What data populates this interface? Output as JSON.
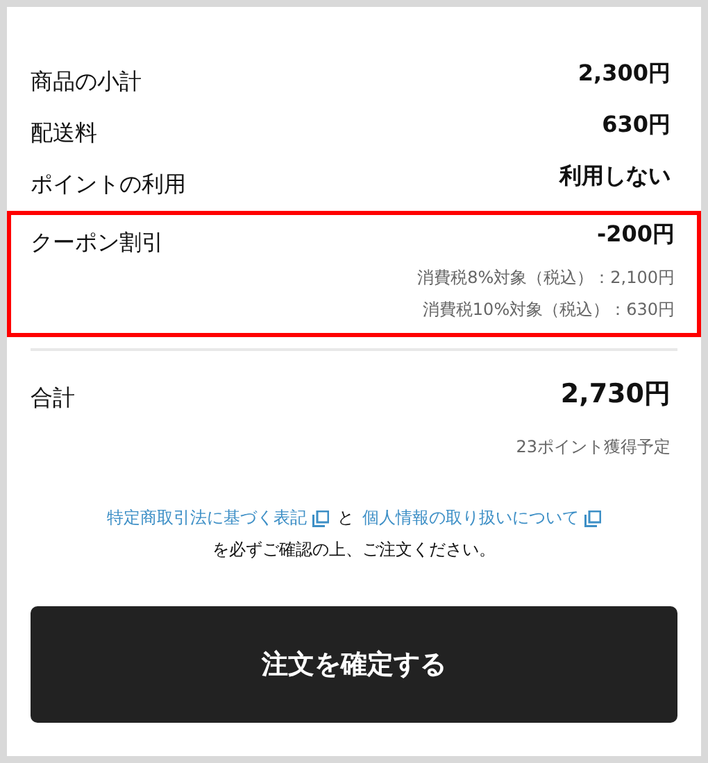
{
  "summary_rows": [
    {
      "label": "商品の小計",
      "value": "2,300円",
      "highlighted": false
    },
    {
      "label": "配送料",
      "value": "630円",
      "highlighted": false
    },
    {
      "label": "ポイントの利用",
      "value": "利用しない",
      "highlighted": false
    },
    {
      "label": "クーポン割引",
      "value": "-200円",
      "highlighted": true,
      "details": [
        "消費税8%対象（税込）：2,100円",
        "消費税10%対象（税込）：630円"
      ]
    }
  ],
  "total": {
    "label": "合計",
    "value": "2,730円",
    "points_note": "23ポイント獲得予定"
  },
  "notice": {
    "links": [
      "特定商取引法に基づく表記",
      "個人情報の取り扱いについて"
    ],
    "joiner": "と",
    "text": "を必ずご確認の上、ご注文ください。"
  },
  "confirm_button": "注文を確定する"
}
